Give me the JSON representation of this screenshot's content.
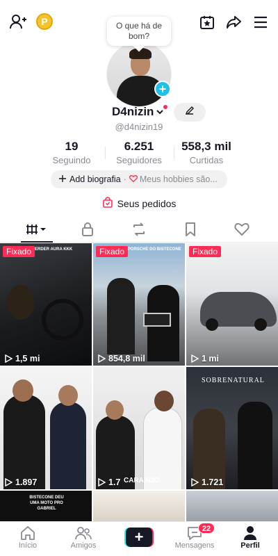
{
  "header": {
    "bubble_text": "O que há de bom?"
  },
  "profile": {
    "display_name": "D4nizin",
    "username": "@d4nizin19"
  },
  "stats": [
    {
      "value": "19",
      "label": "Seguindo"
    },
    {
      "value": "6.251",
      "label": "Seguidores"
    },
    {
      "value": "558,3 mil",
      "label": "Curtidas"
    }
  ],
  "bio": {
    "add_label": "Add biografia",
    "separator": "·",
    "hobbies_label": "Meus hobbies são..."
  },
  "orders_label": "Seus pedidos",
  "videos": [
    {
      "pinned_label": "Fixado",
      "views": "1,5 mi",
      "caption": "PERDER AURA KKK"
    },
    {
      "pinned_label": "Fixado",
      "views": "854,8 mil",
      "caption": "A PORSCHE DO BISTECONE"
    },
    {
      "pinned_label": "Fixado",
      "views": "1 mi",
      "caption": ""
    },
    {
      "pinned_label": "",
      "views": "1.897",
      "caption": ""
    },
    {
      "pinned_label": "",
      "views": "1.7",
      "caption": "CARA N3O"
    },
    {
      "pinned_label": "",
      "views": "1.721",
      "caption": "SOBRENATURAL"
    },
    {
      "pinned_label": "",
      "views": "",
      "caption": "BISTECONE DEU UMA MOTO PRO GABRIEL"
    }
  ],
  "bottom_nav": {
    "home": "Início",
    "friends": "Amigos",
    "messages": "Mensagens",
    "messages_badge": "22",
    "profile": "Perfil"
  },
  "colors": {
    "accent": "#fe2c55",
    "cyan": "#25f4ee",
    "text": "#161823",
    "muted": "#8a8b91"
  }
}
